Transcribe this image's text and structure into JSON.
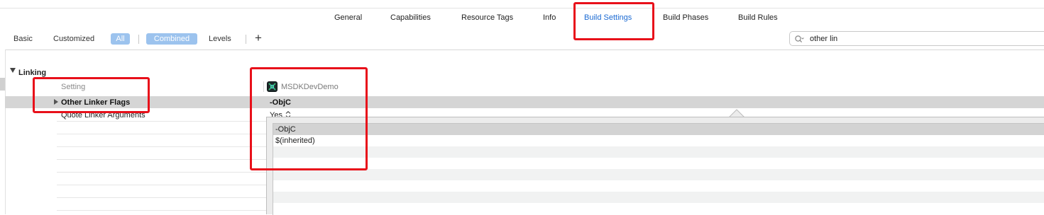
{
  "tabs": [
    {
      "label": "General",
      "active": false
    },
    {
      "label": "Capabilities",
      "active": false
    },
    {
      "label": "Resource Tags",
      "active": false
    },
    {
      "label": "Info",
      "active": false
    },
    {
      "label": "Build Settings",
      "active": true
    },
    {
      "label": "Build Phases",
      "active": false
    },
    {
      "label": "Build Rules",
      "active": false
    }
  ],
  "filter": {
    "basic": "Basic",
    "customized": "Customized",
    "all": "All",
    "combined": "Combined",
    "levels": "Levels",
    "add": "+"
  },
  "search": {
    "value": "other lin",
    "icon": "search-icon"
  },
  "section": {
    "title": "Linking"
  },
  "headers": {
    "setting": "Setting",
    "project": "MSDKDevDemo"
  },
  "rows": [
    {
      "name": "Other Linker Flags",
      "value": "-ObjC"
    },
    {
      "name": "Quote Linker Arguments",
      "value": "Yes"
    }
  ],
  "popover": {
    "items": [
      "-ObjC",
      "$(inherited)"
    ]
  },
  "colors": {
    "accent": "#1b6ad3",
    "annotation": "#e8101a",
    "pill": "#9cc3ee",
    "selection": "#d5d5d5"
  }
}
